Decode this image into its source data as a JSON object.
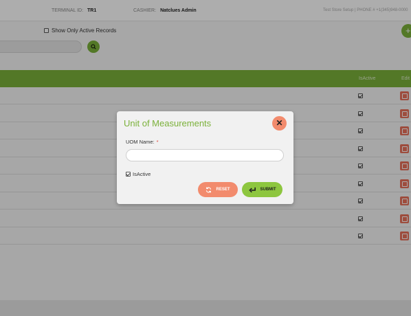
{
  "header": {
    "terminal_label": "TERMINAL ID:",
    "terminal_value": "TR1",
    "cashier_label": "CASHIER:",
    "cashier_value": "Natclues Admin",
    "right_text": "Test Store Setup | PHONE # +1(345)948-0000"
  },
  "filters": {
    "active_only_label": "Show Only Active Records",
    "search_placeholder": "",
    "add_label": "+"
  },
  "table": {
    "columns": [
      "IsActive",
      "Edit"
    ],
    "rows": [
      {
        "is_active": true
      },
      {
        "is_active": true
      },
      {
        "is_active": true
      },
      {
        "is_active": true
      },
      {
        "is_active": true
      },
      {
        "is_active": true
      },
      {
        "is_active": true
      },
      {
        "is_active": true
      },
      {
        "is_active": true
      }
    ]
  },
  "modal": {
    "title": "Unit of Measurements",
    "close_glyph": "✕",
    "uom_label": "UOM Name:",
    "required_mark": "*",
    "uom_value": "",
    "is_active_label": "IsActive",
    "is_active_checked": true,
    "reset_label": "RESET",
    "submit_label": "SUBMIT"
  },
  "colors": {
    "accent_green": "#7bb13a",
    "reset_orange": "#f28b6d",
    "submit_green": "#8dc63f"
  }
}
